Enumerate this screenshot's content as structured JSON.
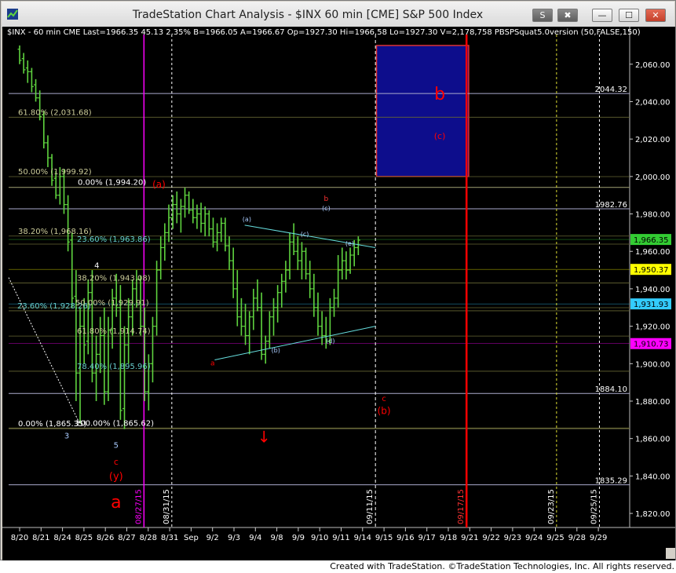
{
  "window": {
    "title": "TradeStation Chart Analysis - $INX 60 min [CME] S&P 500 Index",
    "buttons": [
      "S",
      "✖",
      "—",
      "☐",
      "✕"
    ]
  },
  "info_bar": {
    "symbol": "$INX - 60 min",
    "exchange": "CME",
    "last": "Last=1966.35",
    "change": "45.13",
    "change_pct": "2.35%",
    "bid": "B=1966.05",
    "ask": "A=1966.67",
    "open": "Op=1927.30",
    "high": "Hi=1966.58",
    "low": "Lo=1927.30",
    "volume": "V=2,178,758",
    "study": "PBSPSquat5.0version (50,FALSE,150)"
  },
  "footer": {
    "credit": "Created with TradeStation. ©TradeStation Technologies, Inc. All rights reserved."
  },
  "colors": {
    "bars": "#5fd33f",
    "last_price_tag": "#33cc33",
    "tag_yellow": "#ffff00",
    "tag_cyan": "#33ccff",
    "tag_magenta": "#ff00ff",
    "blue_box": "#0d0d8c",
    "red_line": "#ff0000"
  },
  "chart_data": {
    "type": "ohlc-bar",
    "title": "$INX 60 min [CME] S&P 500 Index",
    "ylim": [
      1815,
      2075
    ],
    "y_ticks": [
      1820,
      1840,
      1860,
      1880,
      1900,
      1920,
      1940,
      1960,
      1980,
      2000,
      2020,
      2040,
      2060
    ],
    "y_tick_labels": [
      "1,820.00",
      "1,840.00",
      "1,860.00",
      "1,880.00",
      "1,900.00",
      "1,920.00",
      "1,940.00",
      "1,960.00",
      "1,980.00",
      "2,000.00",
      "2,020.00",
      "2,040.00",
      "2,060.00"
    ],
    "x_labels": [
      "8/20",
      "8/21",
      "8/24",
      "8/25",
      "8/26",
      "8/27",
      "8/28",
      "8/31",
      "Sep",
      "9/2",
      "9/3",
      "9/4",
      "9/8",
      "9/9",
      "9/10",
      "9/11",
      "9/14",
      "9/15",
      "9/16",
      "9/17",
      "9/18",
      "9/21",
      "9/22",
      "9/23",
      "9/24",
      "9/25",
      "9/28",
      "9/29"
    ],
    "vertical_date_labels": [
      "08/27/15",
      "08/31/15",
      "09/11/15",
      "09/17/15",
      "09/23/15",
      "09/25/15"
    ],
    "horizontal_levels": [
      2044.32,
      1994.2,
      1982.76,
      1884.1,
      1865.35,
      1835.29
    ],
    "level_labels": [
      "2044.32",
      "1982.76",
      "1884.10",
      "1835.29"
    ],
    "price_tags": [
      {
        "value": 1966.35,
        "label": "1,966.35",
        "color": "last_price_tag"
      },
      {
        "value": 1950.37,
        "label": "1,950.37",
        "color": "tag_yellow"
      },
      {
        "value": 1931.93,
        "label": "1,931.93",
        "color": "tag_cyan"
      },
      {
        "value": 1910.73,
        "label": "1,910.73",
        "color": "tag_magenta"
      }
    ],
    "fib_labels": [
      {
        "text": "61.80% (2,031.68)",
        "value": 2031.68
      },
      {
        "text": "50.00% (1,999.92)",
        "value": 1999.92
      },
      {
        "text": "0.00% (1,994.20)",
        "value": 1994.2
      },
      {
        "text": "38.20% (1,968.16)",
        "value": 1968.16
      },
      {
        "text": "23.60% (1,963.86)",
        "value": 1963.86
      },
      {
        "text": "38.20% (1,943.08)",
        "value": 1943.08
      },
      {
        "text": "23.60% (1,928.26)",
        "value": 1928.26
      },
      {
        "text": "50.00% (1,929.91)",
        "value": 1929.91
      },
      {
        "text": "61.80% (1,914.74)",
        "value": 1914.74
      },
      {
        "text": "78.40% (1,895.96)",
        "value": 1895.96
      },
      {
        "text": "0.00% (1,865.35)",
        "value": 1865.35
      },
      {
        "text": "100.00% (1,865.62)",
        "value": 1865.62
      }
    ],
    "wave_labels": [
      "(a)",
      "a",
      "b",
      "(c)",
      "(a)",
      "(b)",
      "(c)",
      "(d)",
      "(e)",
      "c",
      "(b)",
      "3",
      "4",
      "5",
      "c",
      "(y)",
      "a",
      "b"
    ],
    "bars": [
      [
        2068,
        2070,
        2060,
        2062
      ],
      [
        2063,
        2066,
        2055,
        2057
      ],
      [
        2058,
        2062,
        2050,
        2056
      ],
      [
        2056,
        2058,
        2045,
        2048
      ],
      [
        2049,
        2052,
        2040,
        2042
      ],
      [
        2042,
        2046,
        2030,
        2032
      ],
      [
        2033,
        2035,
        2015,
        2018
      ],
      [
        2018,
        2022,
        2005,
        2010
      ],
      [
        2010,
        2012,
        1995,
        1998
      ],
      [
        1999,
        2003,
        1988,
        1990
      ],
      [
        1990,
        2005,
        1985,
        2000
      ],
      [
        2000,
        2004,
        1980,
        1985
      ],
      [
        1985,
        1990,
        1960,
        1965
      ],
      [
        1966,
        1970,
        1930,
        1935
      ],
      [
        1936,
        1950,
        1880,
        1895
      ],
      [
        1895,
        1930,
        1868,
        1920
      ],
      [
        1920,
        1935,
        1900,
        1910
      ],
      [
        1912,
        1945,
        1905,
        1938
      ],
      [
        1938,
        1950,
        1890,
        1895
      ],
      [
        1895,
        1915,
        1880,
        1905
      ],
      [
        1905,
        1925,
        1895,
        1915
      ],
      [
        1915,
        1930,
        1878,
        1885
      ],
      [
        1885,
        1925,
        1880,
        1918
      ],
      [
        1918,
        1940,
        1908,
        1935
      ],
      [
        1935,
        1948,
        1925,
        1930
      ],
      [
        1930,
        1942,
        1870,
        1875
      ],
      [
        1876,
        1920,
        1865,
        1910
      ],
      [
        1910,
        1935,
        1900,
        1925
      ],
      [
        1925,
        1945,
        1915,
        1940
      ],
      [
        1940,
        1950,
        1930,
        1945
      ],
      [
        1945,
        1947,
        1915,
        1920
      ],
      [
        1920,
        1930,
        1880,
        1885
      ],
      [
        1885,
        1905,
        1875,
        1900
      ],
      [
        1900,
        1925,
        1890,
        1920
      ],
      [
        1920,
        1955,
        1915,
        1950
      ],
      [
        1950,
        1968,
        1945,
        1962
      ],
      [
        1962,
        1975,
        1955,
        1970
      ],
      [
        1970,
        1985,
        1965,
        1978
      ],
      [
        1978,
        1990,
        1972,
        1985
      ],
      [
        1985,
        1992,
        1975,
        1980
      ],
      [
        1980,
        1988,
        1970,
        1984
      ],
      [
        1984,
        1994,
        1978,
        1990
      ],
      [
        1990,
        1992,
        1980,
        1982
      ],
      [
        1982,
        1988,
        1975,
        1978
      ],
      [
        1978,
        1985,
        1972,
        1980
      ],
      [
        1980,
        1986,
        1970,
        1975
      ],
      [
        1975,
        1984,
        1968,
        1980
      ],
      [
        1980,
        1982,
        1968,
        1972
      ],
      [
        1972,
        1978,
        1962,
        1965
      ],
      [
        1965,
        1975,
        1960,
        1970
      ],
      [
        1970,
        1978,
        1965,
        1975
      ],
      [
        1975,
        1978,
        1960,
        1963
      ],
      [
        1963,
        1968,
        1950,
        1955
      ],
      [
        1955,
        1962,
        1935,
        1940
      ],
      [
        1940,
        1950,
        1920,
        1925
      ],
      [
        1925,
        1935,
        1915,
        1920
      ],
      [
        1920,
        1932,
        1910,
        1915
      ],
      [
        1915,
        1928,
        1905,
        1925
      ],
      [
        1925,
        1940,
        1918,
        1935
      ],
      [
        1935,
        1945,
        1928,
        1930
      ],
      [
        1930,
        1938,
        1902,
        1905
      ],
      [
        1905,
        1915,
        1900,
        1912
      ],
      [
        1912,
        1928,
        1908,
        1925
      ],
      [
        1925,
        1935,
        1915,
        1930
      ],
      [
        1930,
        1942,
        1922,
        1938
      ],
      [
        1938,
        1948,
        1930,
        1944
      ],
      [
        1944,
        1955,
        1938,
        1950
      ],
      [
        1950,
        1970,
        1945,
        1965
      ],
      [
        1965,
        1975,
        1958,
        1960
      ],
      [
        1960,
        1968,
        1950,
        1955
      ],
      [
        1955,
        1965,
        1945,
        1960
      ],
      [
        1960,
        1962,
        1945,
        1948
      ],
      [
        1948,
        1955,
        1935,
        1940
      ],
      [
        1940,
        1948,
        1925,
        1930
      ],
      [
        1930,
        1938,
        1915,
        1920
      ],
      [
        1920,
        1928,
        1910,
        1915
      ],
      [
        1915,
        1925,
        1908,
        1912
      ],
      [
        1912,
        1935,
        1910,
        1930
      ],
      [
        1930,
        1940,
        1925,
        1935
      ],
      [
        1935,
        1958,
        1930,
        1950
      ],
      [
        1950,
        1962,
        1945,
        1955
      ],
      [
        1955,
        1960,
        1945,
        1950
      ],
      [
        1950,
        1962,
        1948,
        1958
      ],
      [
        1958,
        1966,
        1952,
        1962
      ],
      [
        1962,
        1968,
        1958,
        1966
      ]
    ]
  }
}
